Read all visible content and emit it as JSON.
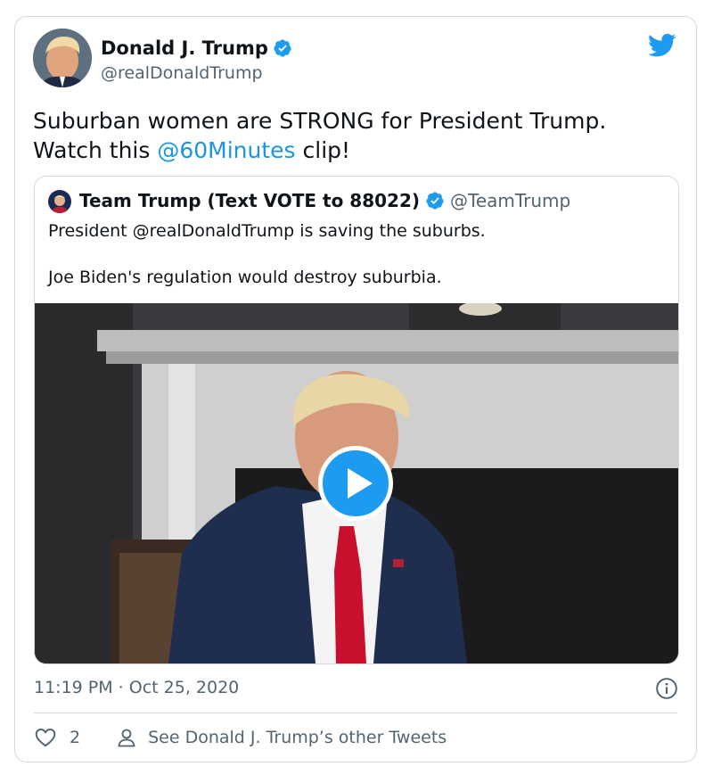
{
  "colors": {
    "accent": "#1d9bf0",
    "mention": "#1b95e0",
    "secondary_text": "#536471",
    "border": "#cfd9de"
  },
  "icons": {
    "bird": "twitter-bird-icon",
    "verified": "verified-badge-icon",
    "play": "play-icon",
    "info": "info-icon",
    "like": "heart-icon",
    "profile": "person-icon"
  },
  "author": {
    "name": "Donald J. Trump",
    "handle": "@realDonaldTrump"
  },
  "tweet": {
    "text_before": "Suburban women are STRONG for President Trump. Watch this ",
    "mention": "@60Minutes",
    "text_after": " clip!"
  },
  "quoted": {
    "name": "Team Trump (Text VOTE to 88022)",
    "handle": "@TeamTrump",
    "line1": "President @realDonaldTrump is saving the suburbs.",
    "line2": "Joe Biden's regulation would destroy suburbia."
  },
  "meta": {
    "timestamp": "11:19 PM · Oct 25, 2020"
  },
  "footer": {
    "like_count": "2",
    "other_tweets": "See Donald J. Trump’s other Tweets"
  }
}
